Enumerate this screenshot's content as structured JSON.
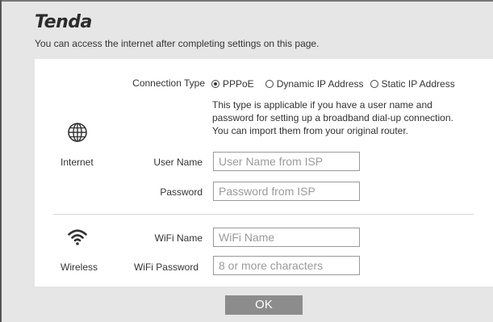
{
  "brand": {
    "logo": "Tenda"
  },
  "header": {
    "subtitle": "You can access the internet after completing settings on this page."
  },
  "internet": {
    "section_label": "Internet",
    "connection_type_label": "Connection Type",
    "options": [
      {
        "label": "PPPoE",
        "selected": true
      },
      {
        "label": "Dynamic IP Address",
        "selected": false
      },
      {
        "label": "Static IP Address",
        "selected": false
      }
    ],
    "description": "This type is applicable if you have a user name and password for setting up a broadband dial-up connection. You can import them from your original router.",
    "username_label": "User Name",
    "username_placeholder": "User Name from ISP",
    "password_label": "Password",
    "password_placeholder": "Password from ISP"
  },
  "wireless": {
    "section_label": "Wireless",
    "wifi_name_label": "WiFi Name",
    "wifi_name_placeholder": "WiFi Name",
    "wifi_password_label": "WiFi Password",
    "wifi_password_placeholder": "8 or more characters"
  },
  "actions": {
    "ok_label": "OK"
  },
  "icons": {
    "internet": "globe-icon",
    "wireless": "wifi-icon"
  }
}
